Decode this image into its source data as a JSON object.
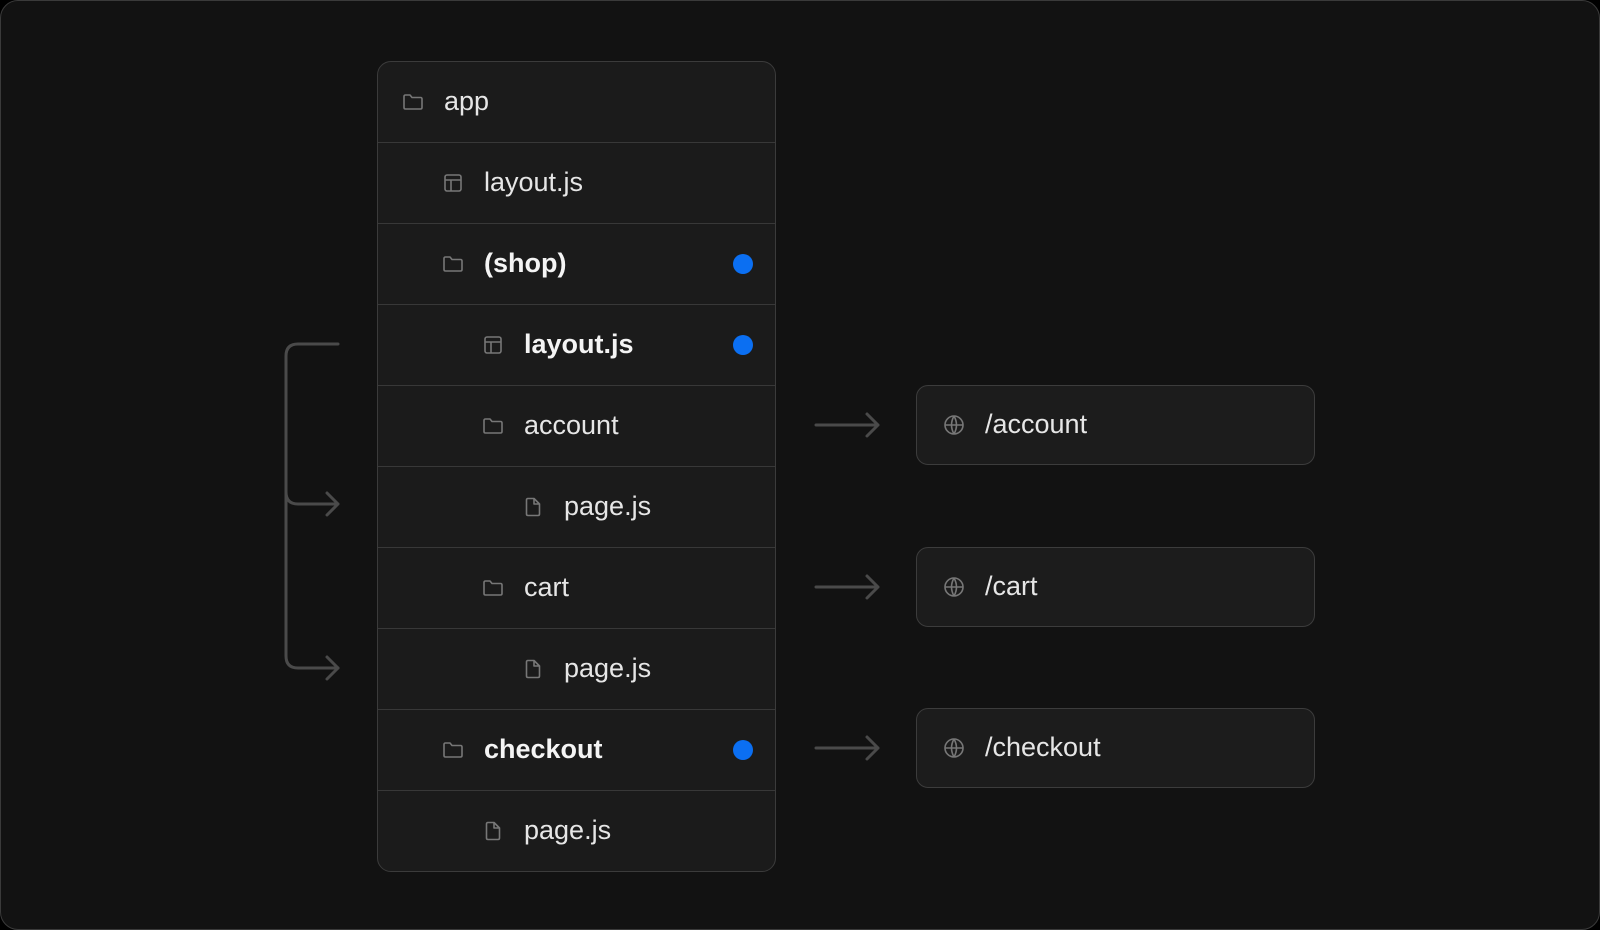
{
  "tree": {
    "items": [
      {
        "label": "app",
        "icon": "folder-icon",
        "level": 0,
        "bold": false,
        "highlight": false
      },
      {
        "label": "layout.js",
        "icon": "layout-icon",
        "level": 1,
        "bold": false,
        "highlight": false
      },
      {
        "label": "(shop)",
        "icon": "folder-icon",
        "level": 1,
        "bold": true,
        "highlight": true
      },
      {
        "label": "layout.js",
        "icon": "layout-icon",
        "level": 2,
        "bold": true,
        "highlight": true
      },
      {
        "label": "account",
        "icon": "folder-icon",
        "level": 2,
        "bold": false,
        "highlight": false
      },
      {
        "label": "page.js",
        "icon": "file-icon",
        "level": 3,
        "bold": false,
        "highlight": false
      },
      {
        "label": "cart",
        "icon": "folder-icon",
        "level": 2,
        "bold": false,
        "highlight": false
      },
      {
        "label": "page.js",
        "icon": "file-icon",
        "level": 3,
        "bold": false,
        "highlight": false
      },
      {
        "label": "checkout",
        "icon": "folder-icon",
        "level": 1,
        "bold": true,
        "highlight": true
      },
      {
        "label": "page.js",
        "icon": "file-icon",
        "level": 2,
        "bold": false,
        "highlight": false
      }
    ]
  },
  "routes": [
    {
      "label": "/account",
      "icon": "globe-icon",
      "from_row": 4
    },
    {
      "label": "/cart",
      "icon": "globe-icon",
      "from_row": 6
    },
    {
      "label": "/checkout",
      "icon": "globe-icon",
      "from_row": 8
    }
  ],
  "bracket": {
    "from_row": 3,
    "to_rows": [
      5,
      7
    ]
  },
  "colors": {
    "background": "#121212",
    "panel": "#1b1b1b",
    "border": "#3b3b3b",
    "highlight_dot": "#0b6ff2",
    "connector": "#4a4a4a",
    "icon": "#777777",
    "text": "#e6e6e6"
  }
}
